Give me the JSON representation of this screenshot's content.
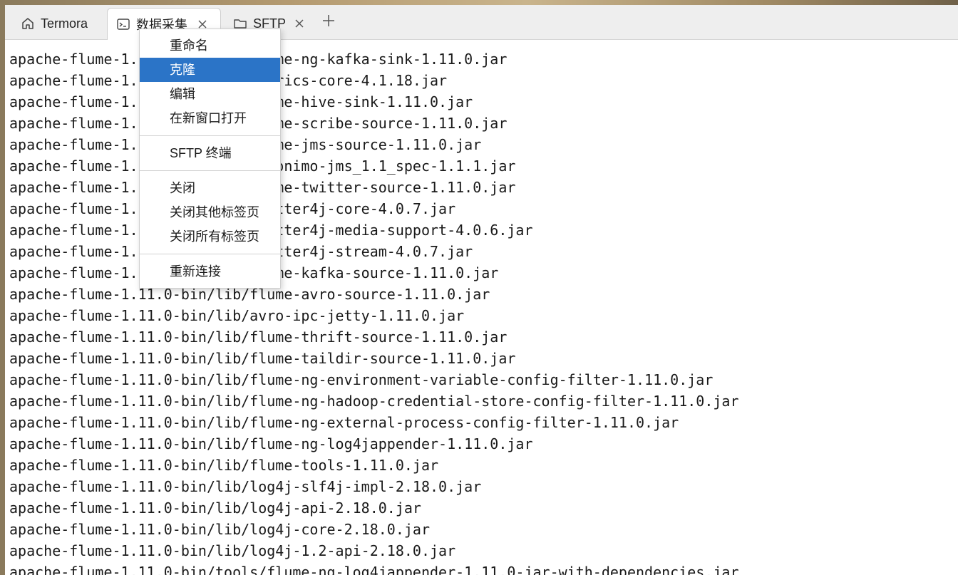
{
  "tabs": [
    {
      "label": "Termora",
      "icon": "home-icon",
      "closable": false,
      "active": false
    },
    {
      "label": "数据采集",
      "icon": "terminal-icon",
      "closable": true,
      "active": true
    },
    {
      "label": "SFTP",
      "icon": "folder-icon",
      "closable": true,
      "active": false
    }
  ],
  "add_tab_icon": "plus-icon",
  "context_menu": {
    "items": [
      {
        "label": "重命名"
      },
      {
        "label": "克隆",
        "highlighted": true
      },
      {
        "label": "编辑"
      },
      {
        "label": "在新窗口打开"
      },
      {
        "label": "SFTP 终端"
      },
      {
        "label": "关闭"
      },
      {
        "label": "关闭其他标签页"
      },
      {
        "label": "关闭所有标签页"
      },
      {
        "label": "重新连接"
      }
    ],
    "highlight_color": "#2b74c7"
  },
  "terminal": {
    "lines": [
      "apache-flume-1.11.0-bin/lib/flume-ng-kafka-sink-1.11.0.jar",
      "apache-flume-1.11.0-bin/lib/metrics-core-4.1.18.jar",
      "apache-flume-1.11.0-bin/lib/flume-hive-sink-1.11.0.jar",
      "apache-flume-1.11.0-bin/lib/flume-scribe-source-1.11.0.jar",
      "apache-flume-1.11.0-bin/lib/flume-jms-source-1.11.0.jar",
      "apache-flume-1.11.0-bin/lib/geronimo-jms_1.1_spec-1.1.1.jar",
      "apache-flume-1.11.0-bin/lib/flume-twitter-source-1.11.0.jar",
      "apache-flume-1.11.0-bin/lib/twitter4j-core-4.0.7.jar",
      "apache-flume-1.11.0-bin/lib/twitter4j-media-support-4.0.6.jar",
      "apache-flume-1.11.0-bin/lib/twitter4j-stream-4.0.7.jar",
      "apache-flume-1.11.0-bin/lib/flume-kafka-source-1.11.0.jar",
      "apache-flume-1.11.0-bin/lib/flume-avro-source-1.11.0.jar",
      "apache-flume-1.11.0-bin/lib/avro-ipc-jetty-1.11.0.jar",
      "apache-flume-1.11.0-bin/lib/flume-thrift-source-1.11.0.jar",
      "apache-flume-1.11.0-bin/lib/flume-taildir-source-1.11.0.jar",
      "apache-flume-1.11.0-bin/lib/flume-ng-environment-variable-config-filter-1.11.0.jar",
      "apache-flume-1.11.0-bin/lib/flume-ng-hadoop-credential-store-config-filter-1.11.0.jar",
      "apache-flume-1.11.0-bin/lib/flume-ng-external-process-config-filter-1.11.0.jar",
      "apache-flume-1.11.0-bin/lib/flume-ng-log4jappender-1.11.0.jar",
      "apache-flume-1.11.0-bin/lib/flume-tools-1.11.0.jar",
      "apache-flume-1.11.0-bin/lib/log4j-slf4j-impl-2.18.0.jar",
      "apache-flume-1.11.0-bin/lib/log4j-api-2.18.0.jar",
      "apache-flume-1.11.0-bin/lib/log4j-core-2.18.0.jar",
      "apache-flume-1.11.0-bin/lib/log4j-1.2-api-2.18.0.jar",
      "apache-flume-1.11.0-bin/tools/flume-ng-log4jappender-1.11.0-jar-with-dependencies.jar"
    ]
  }
}
